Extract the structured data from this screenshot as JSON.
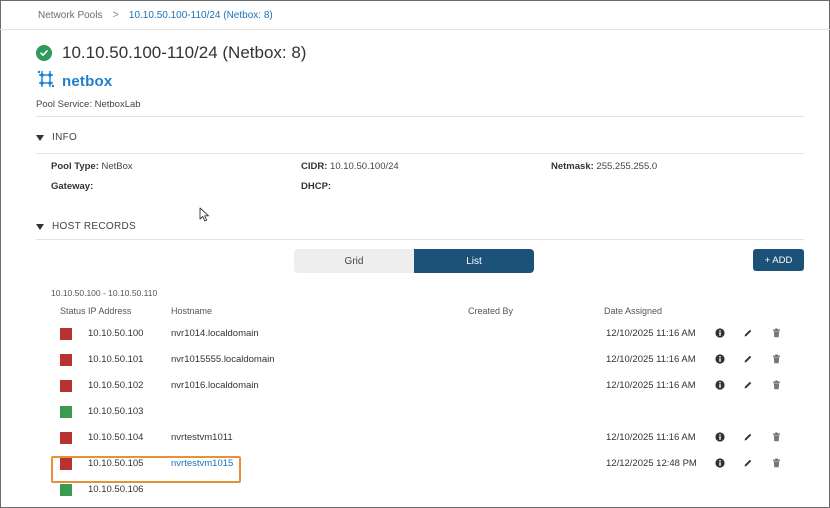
{
  "breadcrumb": {
    "parent": "Network Pools",
    "separator": ">",
    "current": "10.10.50.100-110/24 (Netbox: 8)"
  },
  "page": {
    "title": "10.10.50.100-110/24 (Netbox: 8)",
    "status_icon": "check-circle-icon",
    "status_color": "#2e9a5c"
  },
  "logo": {
    "word": "netbox",
    "color": "#1e7fd0"
  },
  "pool_service": "Pool Service: NetboxLab",
  "info": {
    "heading": "INFO",
    "pool_type_label": "Pool Type:",
    "pool_type_value": "NetBox",
    "cidr_label": "CIDR:",
    "cidr_value": "10.10.50.100/24",
    "netmask_label": "Netmask:",
    "netmask_value": "255.255.255.0",
    "gateway_label": "Gateway:",
    "dhcp_label": "DHCP:"
  },
  "host_records": {
    "heading": "HOST RECORDS",
    "view_toggle": {
      "grid": "Grid",
      "list": "List",
      "selected": "List"
    },
    "add_button": "+ ADD",
    "range": "10.10.50.100 - 10.10.50.110",
    "columns": {
      "status_ip": "Status IP Address",
      "hostname": "Hostname",
      "created_by": "Created By",
      "date_assigned": "Date Assigned"
    },
    "rows": [
      {
        "status": "used",
        "ip": "10.10.50.100",
        "hostname": "nvr1014.localdomain",
        "created_by": "",
        "date": "12/10/2025 11:16 AM"
      },
      {
        "status": "used",
        "ip": "10.10.50.101",
        "hostname": "nvr1015555.localdomain",
        "created_by": "",
        "date": "12/10/2025 11:16 AM"
      },
      {
        "status": "used",
        "ip": "10.10.50.102",
        "hostname": "nvr1016.localdomain",
        "created_by": "",
        "date": "12/10/2025 11:16 AM"
      },
      {
        "status": "free",
        "ip": "10.10.50.103",
        "hostname": "",
        "created_by": "",
        "date": ""
      },
      {
        "status": "used",
        "ip": "10.10.50.104",
        "hostname": "nvrtestvm1011",
        "created_by": "",
        "date": "12/10/2025 11:16 AM"
      },
      {
        "status": "used",
        "ip": "10.10.50.105",
        "hostname": "nvrtestvm1015",
        "created_by": "",
        "date": "12/12/2025 12:48 PM",
        "link": true,
        "highlighted": true
      },
      {
        "status": "free",
        "ip": "10.10.50.106",
        "hostname": "",
        "created_by": "",
        "date": ""
      }
    ],
    "status_colors": {
      "used": "#b83232",
      "free": "#3a9a4f"
    },
    "row_actions": [
      "info-icon",
      "edit-pencil-icon",
      "delete-trash-icon"
    ]
  },
  "colors": {
    "primary": "#1d5278",
    "link": "#1a72b8",
    "highlight_border": "#e69138"
  }
}
